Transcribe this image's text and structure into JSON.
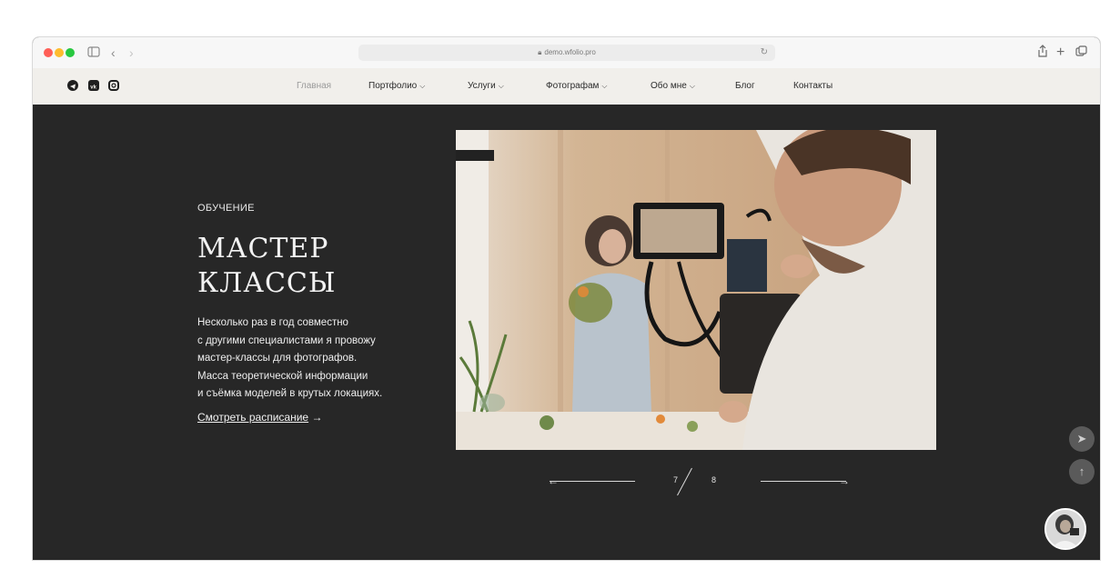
{
  "browser": {
    "url": "demo.wfolio.pro"
  },
  "nav": {
    "items": [
      {
        "label": "Главная",
        "dropdown": false
      },
      {
        "label": "Портфолио",
        "dropdown": true
      },
      {
        "label": "Услуги",
        "dropdown": true
      },
      {
        "label": "Фотографам",
        "dropdown": true
      },
      {
        "label": "Обо мне",
        "dropdown": true
      },
      {
        "label": "Блог",
        "dropdown": false
      },
      {
        "label": "Контакты",
        "dropdown": false
      }
    ],
    "social_icons": [
      "telegram-icon",
      "vk-icon",
      "instagram-icon"
    ]
  },
  "hero": {
    "eyebrow": "ОБУЧЕНИЕ",
    "title_line1": "МАСТЕР",
    "title_line2": "КЛАССЫ",
    "description_lines": [
      "Несколько раз в год совместно",
      "с другими специалистами я провожу",
      "мастер-классы для фотографов.",
      "Масса теоретической информации",
      "и съёмка моделей в крутых локациях."
    ],
    "link_label": "Смотреть расписание",
    "link_arrow": "→"
  },
  "slider": {
    "current": "7",
    "total": "8"
  },
  "colors": {
    "background": "#272727",
    "navbar": "#f1efeb",
    "text_light": "#f2f2f2"
  }
}
